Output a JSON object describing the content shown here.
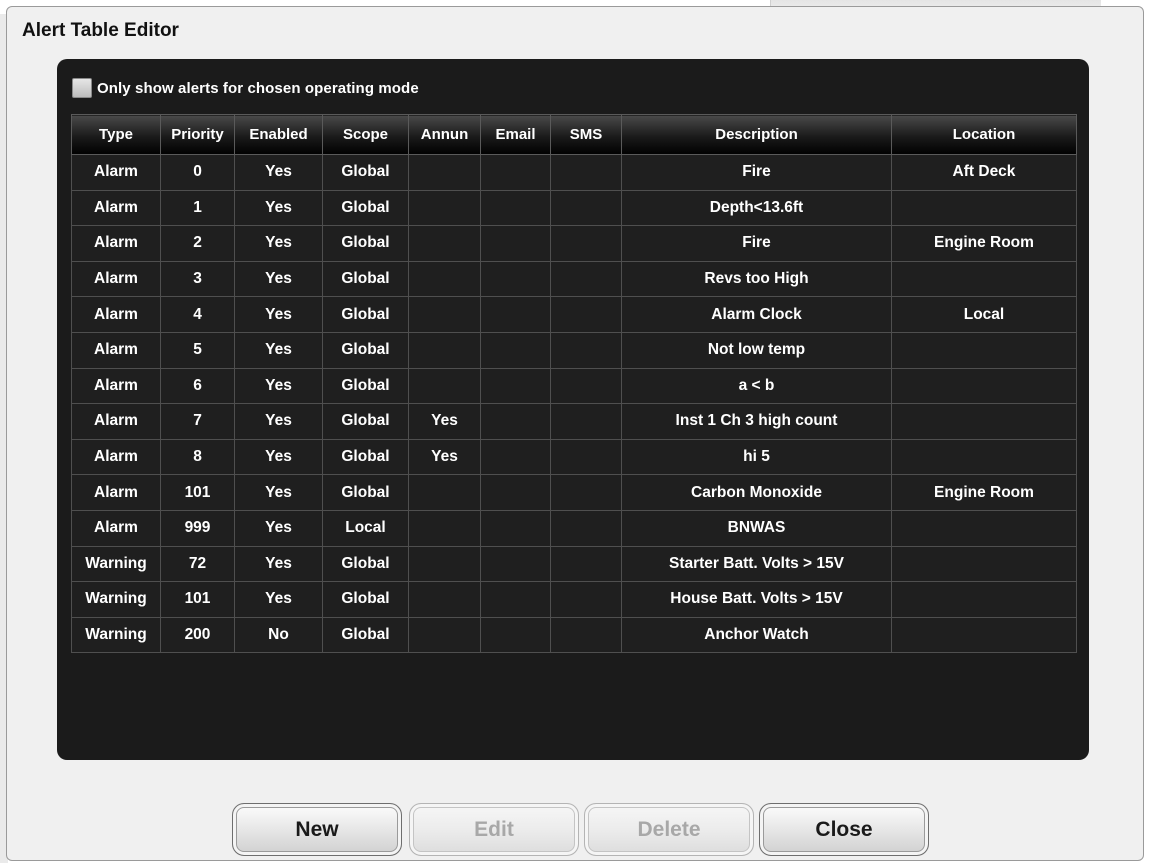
{
  "window": {
    "title": "Alert Table Editor"
  },
  "filter": {
    "label": "Only show alerts for chosen operating mode",
    "checked": false
  },
  "table": {
    "columns": [
      "Type",
      "Priority",
      "Enabled",
      "Scope",
      "Annun",
      "Email",
      "SMS",
      "Description",
      "Location"
    ],
    "rows": [
      [
        "Alarm",
        "0",
        "Yes",
        "Global",
        "",
        "",
        "",
        "Fire",
        "Aft Deck"
      ],
      [
        "Alarm",
        "1",
        "Yes",
        "Global",
        "",
        "",
        "",
        "Depth<13.6ft",
        ""
      ],
      [
        "Alarm",
        "2",
        "Yes",
        "Global",
        "",
        "",
        "",
        "Fire",
        "Engine Room"
      ],
      [
        "Alarm",
        "3",
        "Yes",
        "Global",
        "",
        "",
        "",
        "Revs too High",
        ""
      ],
      [
        "Alarm",
        "4",
        "Yes",
        "Global",
        "",
        "",
        "",
        "Alarm Clock",
        "Local"
      ],
      [
        "Alarm",
        "5",
        "Yes",
        "Global",
        "",
        "",
        "",
        "Not low temp",
        ""
      ],
      [
        "Alarm",
        "6",
        "Yes",
        "Global",
        "",
        "",
        "",
        "a < b",
        ""
      ],
      [
        "Alarm",
        "7",
        "Yes",
        "Global",
        "Yes",
        "",
        "",
        "Inst 1 Ch 3 high count",
        ""
      ],
      [
        "Alarm",
        "8",
        "Yes",
        "Global",
        "Yes",
        "",
        "",
        "hi 5",
        ""
      ],
      [
        "Alarm",
        "101",
        "Yes",
        "Global",
        "",
        "",
        "",
        "Carbon Monoxide",
        "Engine Room"
      ],
      [
        "Alarm",
        "999",
        "Yes",
        "Local",
        "",
        "",
        "",
        "BNWAS",
        ""
      ],
      [
        "Warning",
        "72",
        "Yes",
        "Global",
        "",
        "",
        "",
        "Starter Batt. Volts > 15V",
        ""
      ],
      [
        "Warning",
        "101",
        "Yes",
        "Global",
        "",
        "",
        "",
        "House Batt. Volts > 15V",
        ""
      ],
      [
        "Warning",
        "200",
        "No",
        "Global",
        "",
        "",
        "",
        "Anchor Watch",
        ""
      ]
    ]
  },
  "buttons": {
    "new": "New",
    "edit": "Edit",
    "delete": "Delete",
    "close": "Close"
  },
  "colors": {
    "panel_bg": "#1b1b1b",
    "text": "#ffffff",
    "grid": "#4f4f4f",
    "disabled_text": "#a8a8a8"
  }
}
